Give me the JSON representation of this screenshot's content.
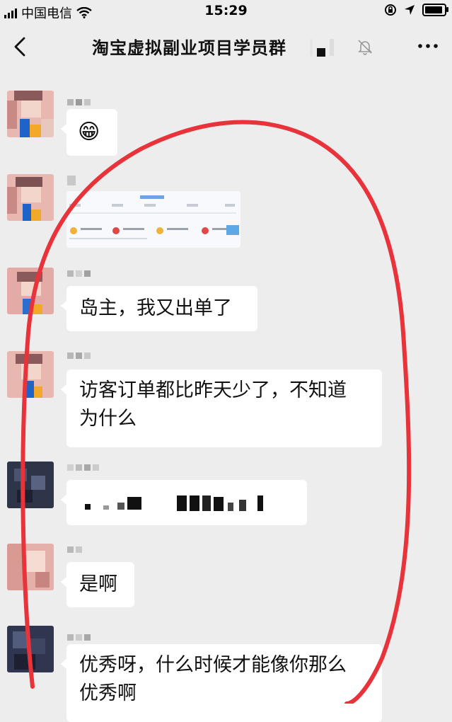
{
  "status_bar": {
    "carrier": "中国电信",
    "time": "15:29"
  },
  "nav": {
    "title": "淘宝虚拟副业项目学员群"
  },
  "messages": [
    {
      "type": "emoji",
      "emoji": "😁"
    },
    {
      "type": "image"
    },
    {
      "type": "text",
      "text": "岛主，我又出单了"
    },
    {
      "type": "text",
      "lines": [
        "访客订单都比昨天少了，不知道",
        "为什么"
      ]
    },
    {
      "type": "text-censored"
    },
    {
      "type": "text",
      "text": "是啊"
    },
    {
      "type": "text",
      "lines": [
        "优秀呀，什么时候才能像你那么",
        "优秀啊"
      ]
    }
  ],
  "colors": {
    "background": "#ededed",
    "bubble": "#ffffff",
    "annotation": "#e8333a"
  }
}
